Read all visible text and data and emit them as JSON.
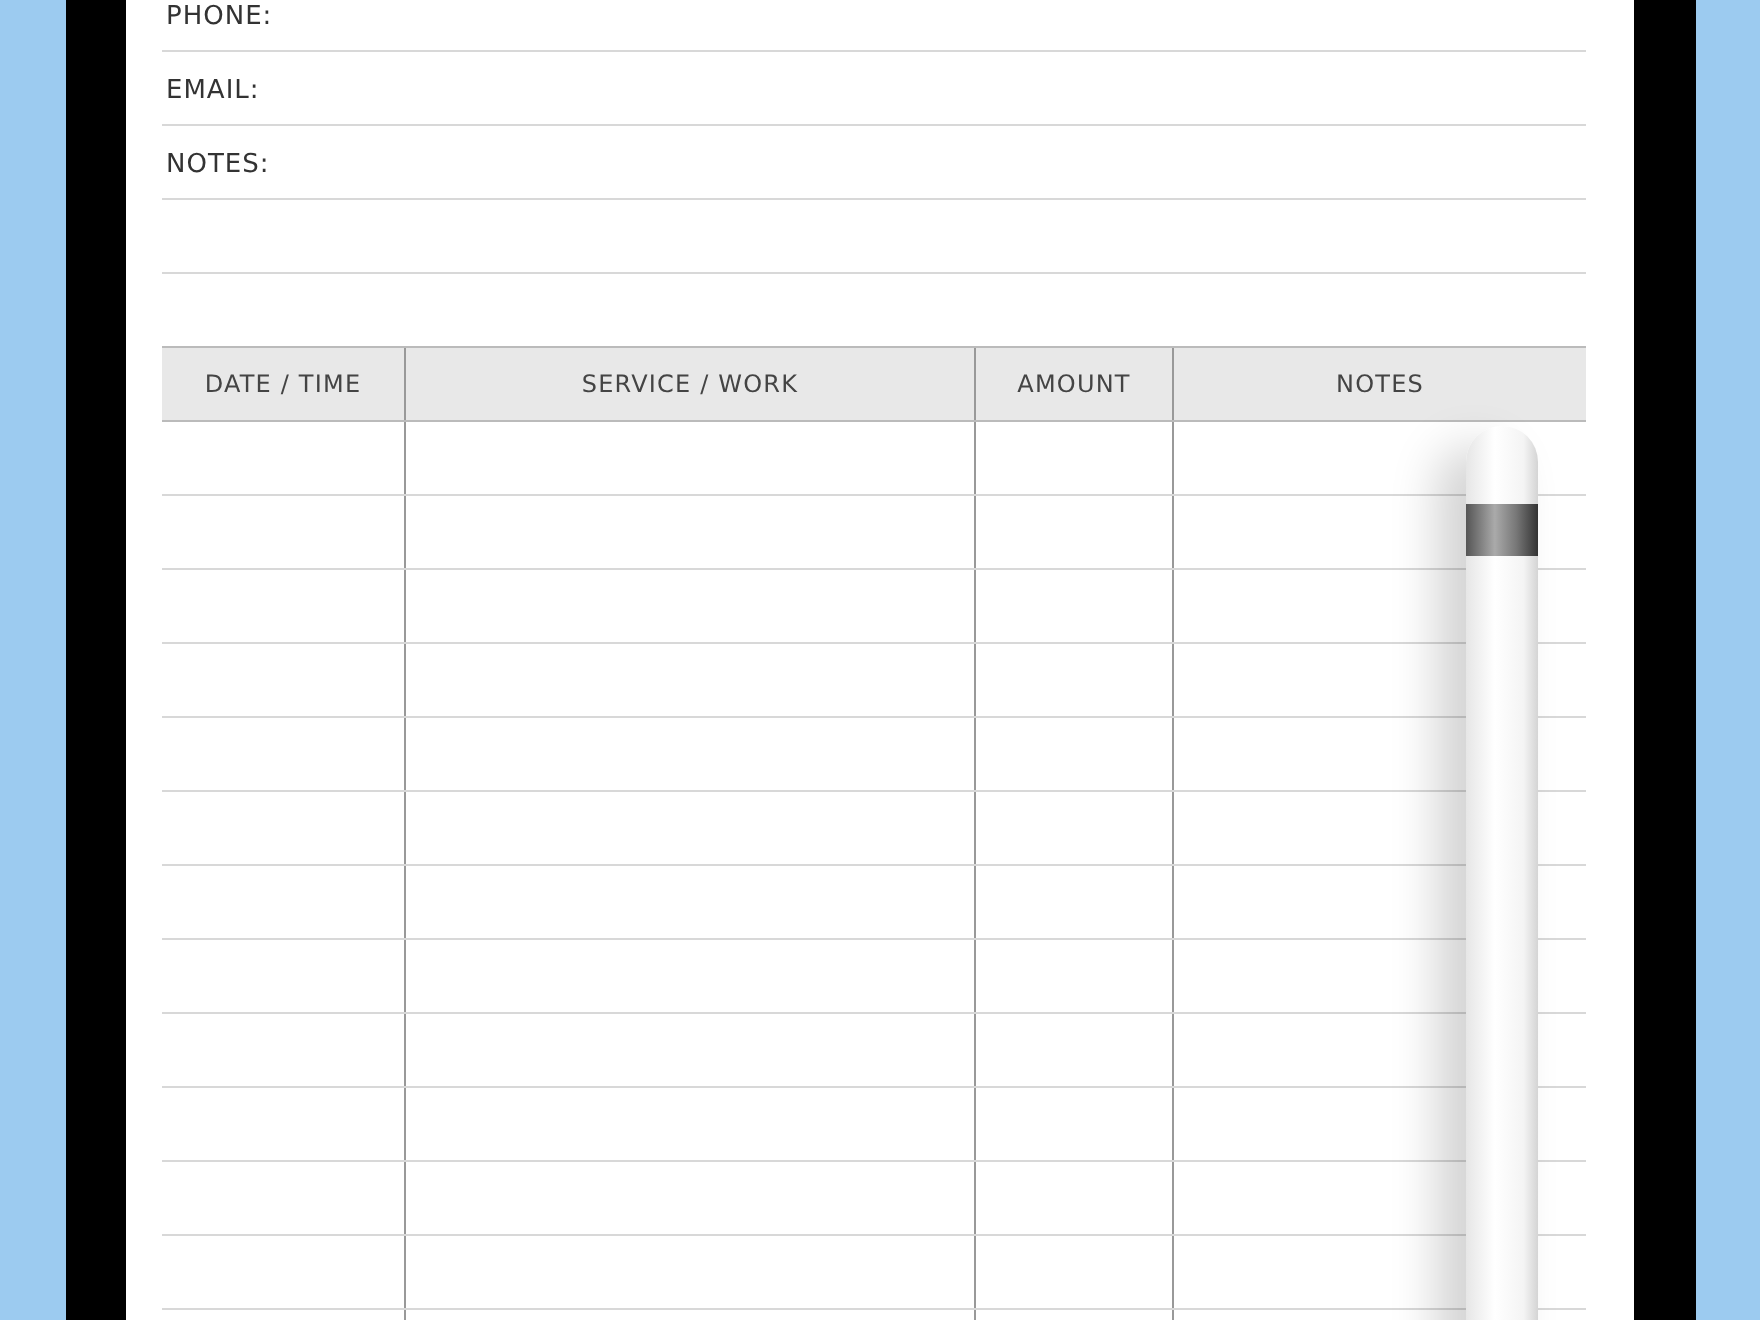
{
  "form_fields": [
    {
      "label": "PHONE:"
    },
    {
      "label": "EMAIL:"
    },
    {
      "label": "NOTES:"
    }
  ],
  "table": {
    "columns": [
      "DATE / TIME",
      "SERVICE / WORK",
      "AMOUNT",
      "NOTES"
    ]
  }
}
